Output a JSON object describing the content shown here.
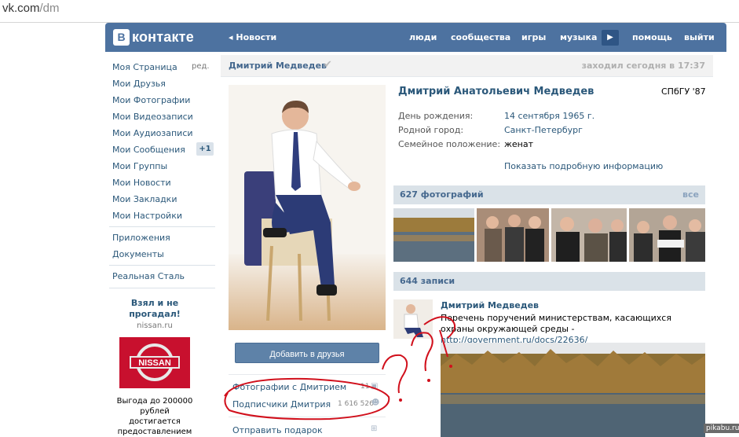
{
  "browser": {
    "address_domain": "vk.com",
    "address_path": "/dm"
  },
  "header": {
    "logo_mark": "В",
    "logo_text": "контакте",
    "back_news": "Новости",
    "nav": [
      "люди",
      "сообщества",
      "игры",
      "музыка",
      "помощь",
      "выйти"
    ]
  },
  "sidebar": {
    "my_page": "Моя Страница",
    "edit": "ред.",
    "items": [
      "Мои Друзья",
      "Мои Фотографии",
      "Мои Видеозаписи",
      "Мои Аудиозаписи",
      "Мои Сообщения",
      "Мои Группы",
      "Мои Новости",
      "Мои Закладки",
      "Мои Настройки"
    ],
    "messages_badge": "+1",
    "apps": "Приложения",
    "docs": "Документы",
    "extra": "Реальная Сталь"
  },
  "ad": {
    "title_line1": "Взял и не",
    "title_line2": "прогадал!",
    "domain": "nissan.ru",
    "brand": "NISSAN",
    "text_lines": [
      "Выгода до 200000",
      "рублей",
      "достигается",
      "предоставлением"
    ]
  },
  "profile": {
    "header_name": "Дмитрий Медведев",
    "last_seen": "заходил сегодня в 17:37",
    "full_name": "Дмитрий Анатольевич Медведев",
    "university": "СПбГУ '87",
    "birthday_label": "День рождения:",
    "birthday_value": "14 сентября 1965 г.",
    "hometown_label": "Родной город:",
    "hometown_value": "Санкт-Петербург",
    "marital_label": "Семейное положение:",
    "marital_value": "женат",
    "show_more": "Показать подробную информацию",
    "add_friend": "Добавить в друзья",
    "photos_with_label": "Фотографии с Дмитрием",
    "photos_with_count": "11",
    "followers_label": "Подписчики Дмитрия",
    "followers_count": "1 616 526",
    "gift_label": "Отправить подарок"
  },
  "photos": {
    "title": "627 фотографий",
    "all": "все"
  },
  "wall": {
    "title": "644 записи",
    "author": "Дмитрий Медведев",
    "text": "Перечень поручений министерствам, касающихся охраны окружающей среды - ",
    "link": "http://government.ru/docs/22636/"
  },
  "watermark": "pikabu.ru",
  "colors": {
    "header_blue": "#4d72a0",
    "link_blue": "#2b587a",
    "annotation_red": "#d1101c"
  }
}
